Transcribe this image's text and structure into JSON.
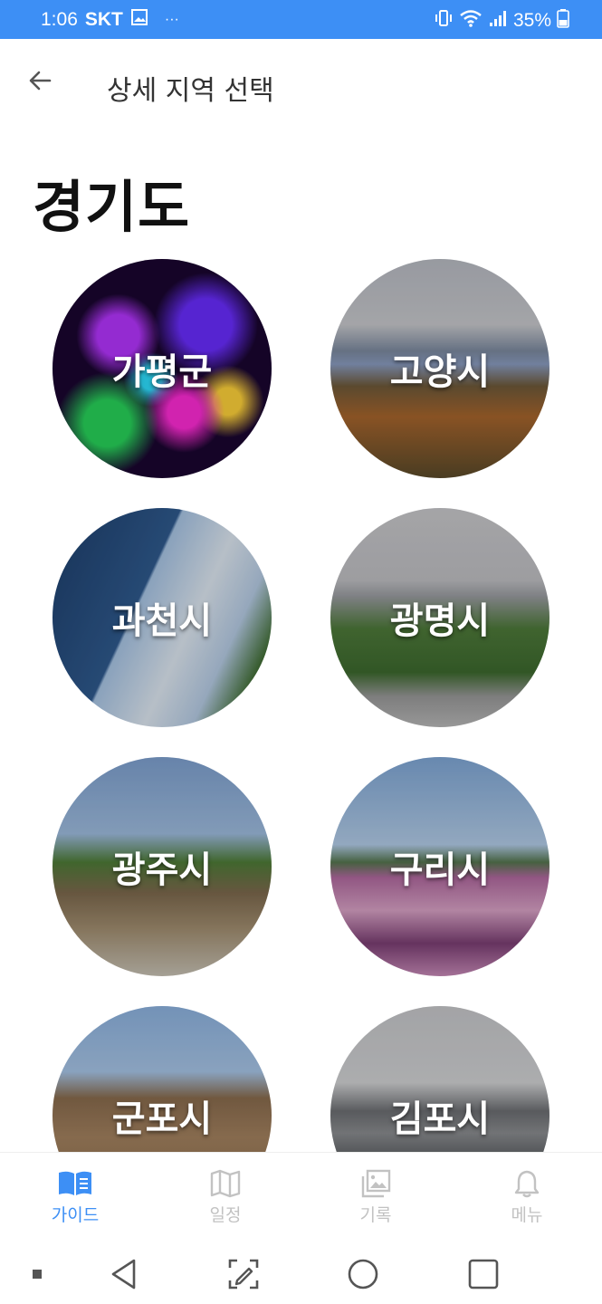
{
  "status_bar": {
    "time": "1:06",
    "carrier": "SKT",
    "more": "···",
    "battery": "35%"
  },
  "app_bar": {
    "back_icon": "arrow-left-icon",
    "title": "상세 지역 선택"
  },
  "region": {
    "name": "경기도"
  },
  "cities": [
    {
      "name": "가평군",
      "icon": "night-light-garden"
    },
    {
      "name": "고양시",
      "icon": "lake-park"
    },
    {
      "name": "과천시",
      "icon": "science-museum"
    },
    {
      "name": "광명시",
      "icon": "station-park"
    },
    {
      "name": "광주시",
      "icon": "fortress-gate"
    },
    {
      "name": "구리시",
      "icon": "cosmos-field"
    },
    {
      "name": "군포시",
      "icon": "mountain"
    },
    {
      "name": "김포시",
      "icon": "bridge"
    }
  ],
  "bottom_nav": {
    "items": [
      {
        "label": "가이드",
        "icon": "book-open-icon",
        "active": true
      },
      {
        "label": "일정",
        "icon": "map-icon",
        "active": false
      },
      {
        "label": "기록",
        "icon": "gallery-icon",
        "active": false
      },
      {
        "label": "메뉴",
        "icon": "bell-icon",
        "active": false
      }
    ]
  },
  "colors": {
    "accent": "#3d8ff5",
    "inactive": "#c2c2c2",
    "title": "#111111"
  }
}
